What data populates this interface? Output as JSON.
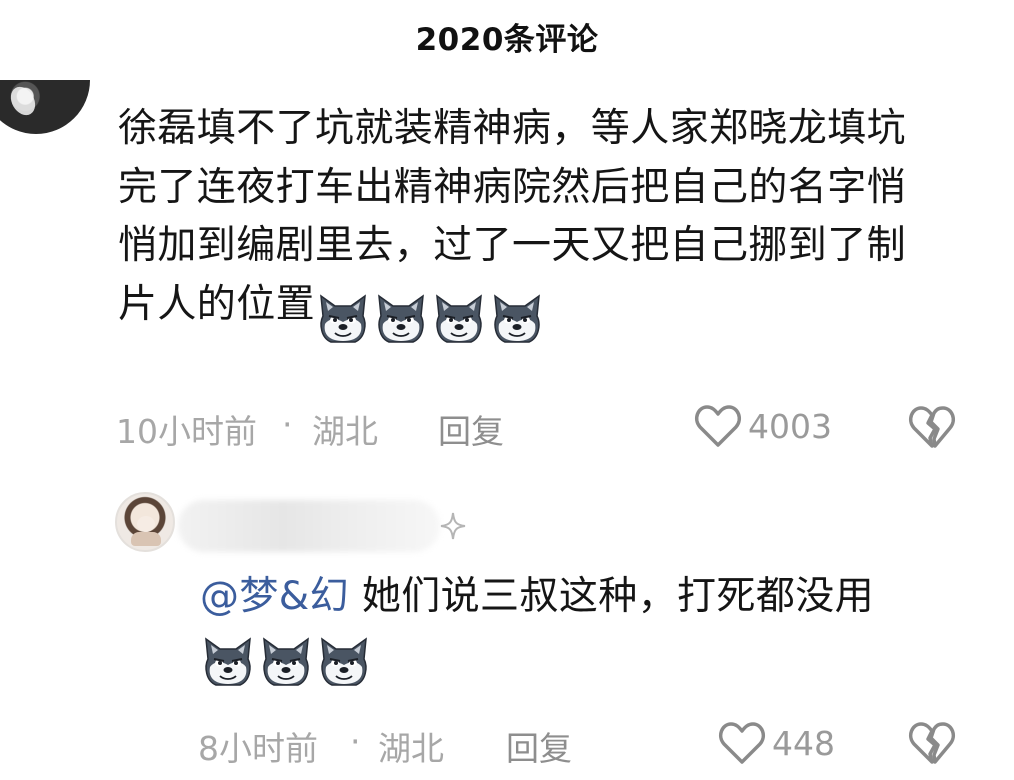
{
  "header": {
    "title": "2020条评论"
  },
  "comment": {
    "text": "徐磊填不了坑就装精神病，等人家郑晓龙填坑完了连夜打车出精神病院然后把自己的名字悄悄加到编剧里去，过了一天又把自己挪到了制片人的位置",
    "emoji_count": 4,
    "emoji_icon": "husky-doge-emoji",
    "time": "10小时前",
    "separator": "·",
    "location": "湖北",
    "reply_label": "回复",
    "like_count": "4003"
  },
  "reply": {
    "mention": "@梦&幻",
    "text": " 她们说三叔这种，打死都没用",
    "emoji_count": 3,
    "emoji_icon": "husky-doge-emoji",
    "time": "8小时前",
    "separator": "·",
    "location": "湖北",
    "reply_label": "回复",
    "like_count": "448"
  },
  "colors": {
    "text": "#151515",
    "meta": "#a7a7a7",
    "mention": "#3b5d9d",
    "icon": "#8a8a8a"
  }
}
